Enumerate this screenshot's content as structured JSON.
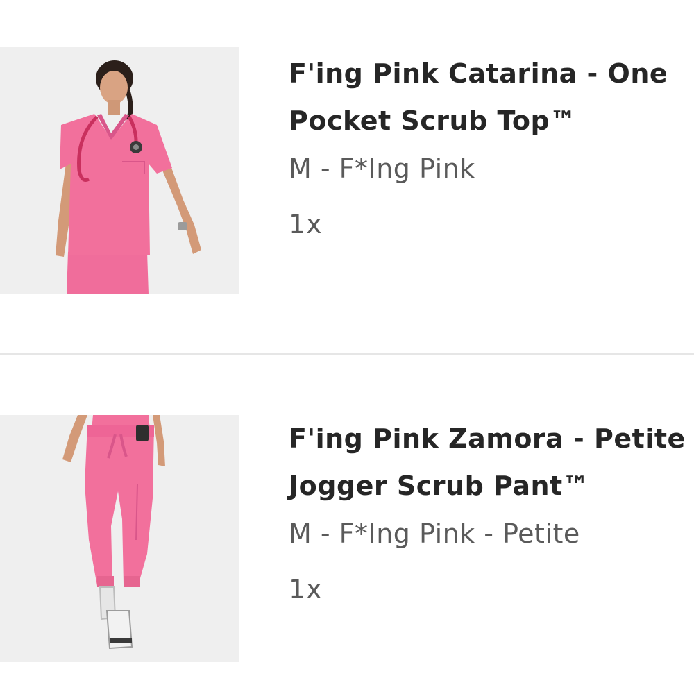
{
  "cart": {
    "items": [
      {
        "title_line1": "F'ing Pink Catarina - One",
        "title_line2": "Pocket Scrub Top™",
        "variant": "M - F*Ing Pink",
        "quantity": "1x",
        "image_icon": "scrub-top-photo"
      },
      {
        "title_line1": "F'ing Pink Zamora - Petite",
        "title_line2": "Jogger Scrub Pant™",
        "variant": "M - F*Ing Pink - Petite",
        "quantity": "1x",
        "image_icon": "jogger-pant-photo"
      }
    ]
  },
  "colors": {
    "product_pink": "#f2709c",
    "background": "#ffffff",
    "title_text": "#262626",
    "secondary_text": "#5a5a5a",
    "divider": "#e6e6e6"
  }
}
